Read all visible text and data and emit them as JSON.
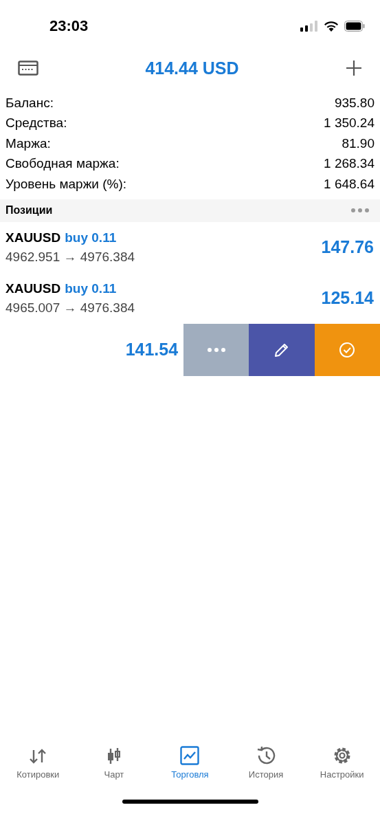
{
  "status_bar": {
    "time": "23:03"
  },
  "header": {
    "title": "414.44 USD"
  },
  "summary": [
    {
      "label": "Баланс:",
      "value": "935.80"
    },
    {
      "label": "Средства:",
      "value": "1 350.24"
    },
    {
      "label": "Маржа:",
      "value": "81.90"
    },
    {
      "label": "Свободная маржа:",
      "value": "1 268.34"
    },
    {
      "label": "Уровень маржи (%):",
      "value": "1 648.64"
    }
  ],
  "positions_header": {
    "title": "Позиции"
  },
  "positions": [
    {
      "kind": "row",
      "symbol": "XAUUSD",
      "side": "buy 0.11",
      "prices": "4962.951 → 4976.384",
      "profit": "147.76"
    },
    {
      "kind": "row",
      "symbol": "XAUUSD",
      "side": "buy 0.11",
      "prices": "4965.007 → 4976.384",
      "profit": "125.14"
    },
    {
      "kind": "swiped",
      "profit": "141.54",
      "actions": [
        {
          "kind": "more"
        },
        {
          "kind": "edit"
        },
        {
          "kind": "close"
        }
      ]
    }
  ],
  "tabs": [
    {
      "label": "Котировки",
      "kind": "quotes",
      "selected": false
    },
    {
      "label": "Чарт",
      "kind": "chart",
      "selected": false
    },
    {
      "label": "Торговля",
      "kind": "trade",
      "selected": true
    },
    {
      "label": "История",
      "kind": "history",
      "selected": false
    },
    {
      "label": "Настройки",
      "kind": "settings",
      "selected": false
    }
  ]
}
